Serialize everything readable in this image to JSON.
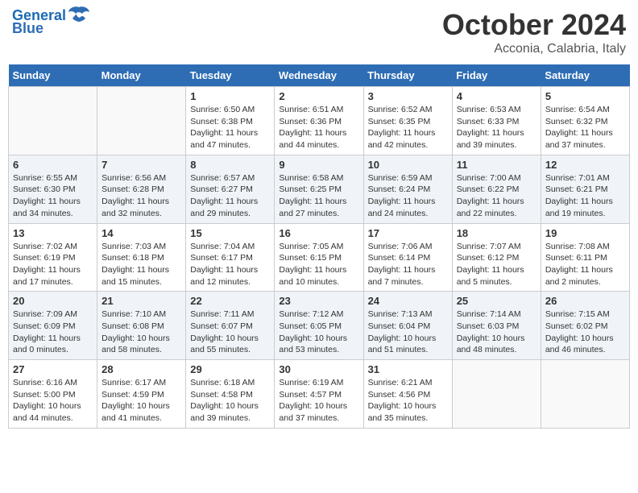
{
  "header": {
    "logo_line1": "General",
    "logo_line2": "Blue",
    "month": "October 2024",
    "location": "Acconia, Calabria, Italy"
  },
  "weekdays": [
    "Sunday",
    "Monday",
    "Tuesday",
    "Wednesday",
    "Thursday",
    "Friday",
    "Saturday"
  ],
  "weeks": [
    [
      {
        "day": "",
        "info": ""
      },
      {
        "day": "",
        "info": ""
      },
      {
        "day": "1",
        "info": "Sunrise: 6:50 AM\nSunset: 6:38 PM\nDaylight: 11 hours and 47 minutes."
      },
      {
        "day": "2",
        "info": "Sunrise: 6:51 AM\nSunset: 6:36 PM\nDaylight: 11 hours and 44 minutes."
      },
      {
        "day": "3",
        "info": "Sunrise: 6:52 AM\nSunset: 6:35 PM\nDaylight: 11 hours and 42 minutes."
      },
      {
        "day": "4",
        "info": "Sunrise: 6:53 AM\nSunset: 6:33 PM\nDaylight: 11 hours and 39 minutes."
      },
      {
        "day": "5",
        "info": "Sunrise: 6:54 AM\nSunset: 6:32 PM\nDaylight: 11 hours and 37 minutes."
      }
    ],
    [
      {
        "day": "6",
        "info": "Sunrise: 6:55 AM\nSunset: 6:30 PM\nDaylight: 11 hours and 34 minutes."
      },
      {
        "day": "7",
        "info": "Sunrise: 6:56 AM\nSunset: 6:28 PM\nDaylight: 11 hours and 32 minutes."
      },
      {
        "day": "8",
        "info": "Sunrise: 6:57 AM\nSunset: 6:27 PM\nDaylight: 11 hours and 29 minutes."
      },
      {
        "day": "9",
        "info": "Sunrise: 6:58 AM\nSunset: 6:25 PM\nDaylight: 11 hours and 27 minutes."
      },
      {
        "day": "10",
        "info": "Sunrise: 6:59 AM\nSunset: 6:24 PM\nDaylight: 11 hours and 24 minutes."
      },
      {
        "day": "11",
        "info": "Sunrise: 7:00 AM\nSunset: 6:22 PM\nDaylight: 11 hours and 22 minutes."
      },
      {
        "day": "12",
        "info": "Sunrise: 7:01 AM\nSunset: 6:21 PM\nDaylight: 11 hours and 19 minutes."
      }
    ],
    [
      {
        "day": "13",
        "info": "Sunrise: 7:02 AM\nSunset: 6:19 PM\nDaylight: 11 hours and 17 minutes."
      },
      {
        "day": "14",
        "info": "Sunrise: 7:03 AM\nSunset: 6:18 PM\nDaylight: 11 hours and 15 minutes."
      },
      {
        "day": "15",
        "info": "Sunrise: 7:04 AM\nSunset: 6:17 PM\nDaylight: 11 hours and 12 minutes."
      },
      {
        "day": "16",
        "info": "Sunrise: 7:05 AM\nSunset: 6:15 PM\nDaylight: 11 hours and 10 minutes."
      },
      {
        "day": "17",
        "info": "Sunrise: 7:06 AM\nSunset: 6:14 PM\nDaylight: 11 hours and 7 minutes."
      },
      {
        "day": "18",
        "info": "Sunrise: 7:07 AM\nSunset: 6:12 PM\nDaylight: 11 hours and 5 minutes."
      },
      {
        "day": "19",
        "info": "Sunrise: 7:08 AM\nSunset: 6:11 PM\nDaylight: 11 hours and 2 minutes."
      }
    ],
    [
      {
        "day": "20",
        "info": "Sunrise: 7:09 AM\nSunset: 6:09 PM\nDaylight: 11 hours and 0 minutes."
      },
      {
        "day": "21",
        "info": "Sunrise: 7:10 AM\nSunset: 6:08 PM\nDaylight: 10 hours and 58 minutes."
      },
      {
        "day": "22",
        "info": "Sunrise: 7:11 AM\nSunset: 6:07 PM\nDaylight: 10 hours and 55 minutes."
      },
      {
        "day": "23",
        "info": "Sunrise: 7:12 AM\nSunset: 6:05 PM\nDaylight: 10 hours and 53 minutes."
      },
      {
        "day": "24",
        "info": "Sunrise: 7:13 AM\nSunset: 6:04 PM\nDaylight: 10 hours and 51 minutes."
      },
      {
        "day": "25",
        "info": "Sunrise: 7:14 AM\nSunset: 6:03 PM\nDaylight: 10 hours and 48 minutes."
      },
      {
        "day": "26",
        "info": "Sunrise: 7:15 AM\nSunset: 6:02 PM\nDaylight: 10 hours and 46 minutes."
      }
    ],
    [
      {
        "day": "27",
        "info": "Sunrise: 6:16 AM\nSunset: 5:00 PM\nDaylight: 10 hours and 44 minutes."
      },
      {
        "day": "28",
        "info": "Sunrise: 6:17 AM\nSunset: 4:59 PM\nDaylight: 10 hours and 41 minutes."
      },
      {
        "day": "29",
        "info": "Sunrise: 6:18 AM\nSunset: 4:58 PM\nDaylight: 10 hours and 39 minutes."
      },
      {
        "day": "30",
        "info": "Sunrise: 6:19 AM\nSunset: 4:57 PM\nDaylight: 10 hours and 37 minutes."
      },
      {
        "day": "31",
        "info": "Sunrise: 6:21 AM\nSunset: 4:56 PM\nDaylight: 10 hours and 35 minutes."
      },
      {
        "day": "",
        "info": ""
      },
      {
        "day": "",
        "info": ""
      }
    ]
  ]
}
